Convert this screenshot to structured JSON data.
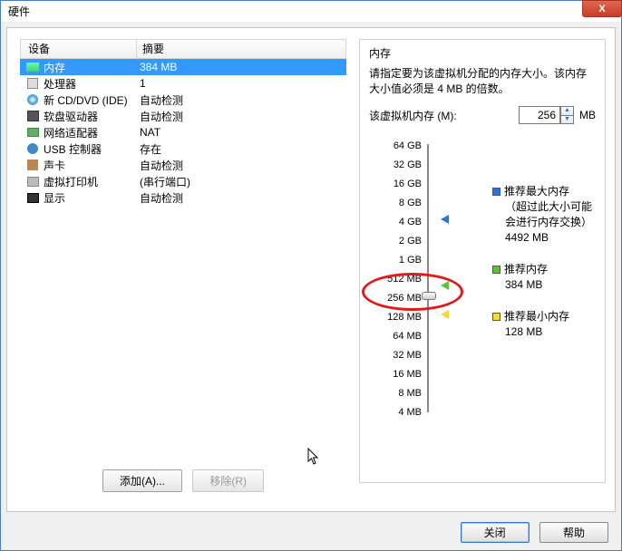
{
  "window": {
    "title": "硬件",
    "close_x": "X"
  },
  "table": {
    "col_device": "设备",
    "col_summary": "摘要"
  },
  "devices": [
    {
      "name": "内存",
      "summary": "384 MB",
      "selected": true,
      "icon": "memory-icon"
    },
    {
      "name": "处理器",
      "summary": "1",
      "icon": "cpu-icon"
    },
    {
      "name": "新 CD/DVD (IDE)",
      "summary": "自动检测",
      "icon": "cd-icon"
    },
    {
      "name": "软盘驱动器",
      "summary": "自动检测",
      "icon": "floppy-icon"
    },
    {
      "name": "网络适配器",
      "summary": "NAT",
      "icon": "network-icon"
    },
    {
      "name": "USB 控制器",
      "summary": "存在",
      "icon": "usb-icon"
    },
    {
      "name": "声卡",
      "summary": "自动检测",
      "icon": "sound-icon"
    },
    {
      "name": "虚拟打印机",
      "summary": "(串行端口)",
      "icon": "printer-icon"
    },
    {
      "name": "显示",
      "summary": "自动检测",
      "icon": "display-icon"
    }
  ],
  "buttons": {
    "add": "添加(A)...",
    "remove": "移除(R)"
  },
  "memory": {
    "section_title": "内存",
    "description": "请指定要为该虚拟机分配的内存大小。该内存大小值必须是 4 MB 的倍数。",
    "input_label": "该虚拟机内存 (M):",
    "value": "256",
    "unit": "MB",
    "ticks": [
      "64 GB",
      "32 GB",
      "16 GB",
      "8 GB",
      "4 GB",
      "2 GB",
      "1 GB",
      "512 MB",
      "256 MB",
      "128 MB",
      "64 MB",
      "32 MB",
      "16 MB",
      "8 MB",
      "4 MB"
    ],
    "legend_max": {
      "title": "推荐最大内存",
      "note1": "（超过此大小可能",
      "note2": "会进行内存交换）",
      "value": "4492 MB"
    },
    "legend_rec": {
      "title": "推荐内存",
      "value": "384 MB"
    },
    "legend_min": {
      "title": "推荐最小内存",
      "value": "128 MB"
    }
  },
  "footer": {
    "close": "关闭",
    "help": "帮助"
  }
}
